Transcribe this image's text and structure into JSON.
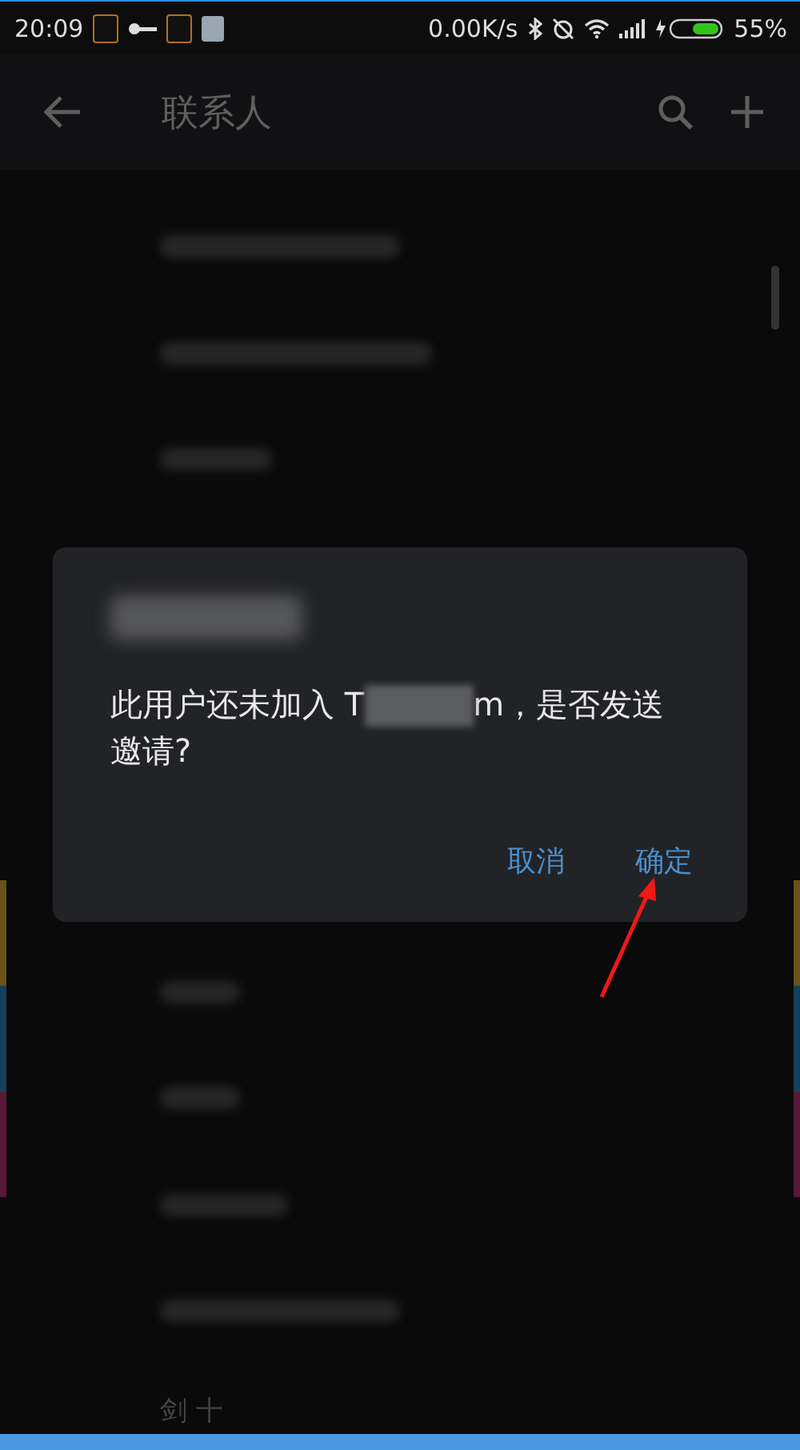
{
  "status_bar": {
    "time": "20:09",
    "speed": "0.00K/s",
    "battery": "55%"
  },
  "app_bar": {
    "title": "联系人"
  },
  "contacts": {
    "last_visible": "剑 十"
  },
  "dialog": {
    "message_start": "此用户还未加入 T",
    "message_end": "m，是否发送",
    "message_line2": "邀请?",
    "buttons": [
      {
        "label": "取消"
      },
      {
        "label": "确定"
      }
    ]
  }
}
